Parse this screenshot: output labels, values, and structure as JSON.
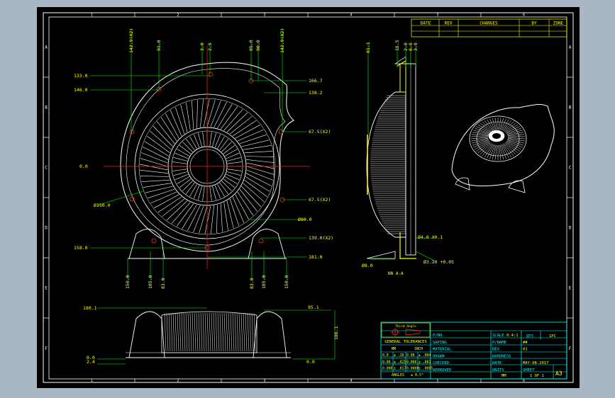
{
  "sheet": {
    "column_numbers": [
      "1",
      "2",
      "3",
      "4",
      "5",
      "6"
    ],
    "row_letters": [
      "A",
      "B",
      "C",
      "D",
      "E",
      "F"
    ]
  },
  "revision_table": {
    "headers": [
      "DATE",
      "REV",
      "CHANGES",
      "BY",
      "ZONE"
    ]
  },
  "front_view": {
    "left_dims": [
      "133.0",
      "146.0",
      "0.0",
      "158.0"
    ],
    "top_dims": [
      "142.9(X2)",
      "91.0",
      "3.0",
      "2.5",
      "85.0",
      "90.0",
      "142.9(X2)"
    ],
    "right_dims": [
      "166.7",
      "138.2",
      "67.5(X2)",
      "67.5(X2)",
      "Ø80.0",
      "139.0(X2)",
      "181.0"
    ],
    "bottom_dims": [
      "150.0",
      "105.0",
      "83.0",
      "83.0",
      "105.0",
      "150.0"
    ],
    "diameter": "Ø350.0"
  },
  "section_view": {
    "dims": [
      "81.1",
      "15.5",
      "2.0",
      "8.0",
      "3.0"
    ],
    "right_dims": [
      "Ø4.0 X0.1",
      "Ø3.20 +0.05"
    ],
    "bottom_dim": "Ø8.0",
    "label": "NN A-A"
  },
  "bottom_view": {
    "dims": [
      "180.1",
      "95.1",
      "186.1",
      "0.0",
      "2.4",
      "0.0"
    ]
  },
  "title_block": {
    "projection_label": "Third Angle",
    "tolerances_title": "GENERAL TOLERANCES",
    "units_mm": "MM",
    "units_inch": "INCH",
    "tol_rows": [
      [
        "0.0",
        "± .10",
        "0.00",
        "± .004"
      ],
      [
        "0.00",
        "± .025",
        "0.000",
        "± .001"
      ],
      [
        "0.000",
        "± .017",
        "0.0000",
        "± .0005"
      ]
    ],
    "angles_label": "ANGLES",
    "angles_value": "± 0.5°",
    "fields": [
      "P/NO.",
      "SAPING",
      "MATERIAL",
      "DRAWN",
      "CHECKED",
      "APPROVED"
    ],
    "right_labels": [
      "SCALE",
      "P/NAME",
      "REV.",
      "HARDNESS",
      "DATE",
      "UNITS"
    ],
    "right_values": [
      "0.4:1",
      "##",
      "01",
      "",
      "MAY-08-2017",
      "MM"
    ],
    "qty_label": "QTY.",
    "qty_value": "1PC",
    "sheet_label": "SHEET",
    "sheet_value": "1 OF 1",
    "size": "A3"
  },
  "colors": {
    "drawing": "#ffffff",
    "dimension": "#00ff00",
    "dimension_text": "#ffff00",
    "center": "#ff0000",
    "title_block": "#00ffff",
    "highlight": "#ffff00"
  }
}
